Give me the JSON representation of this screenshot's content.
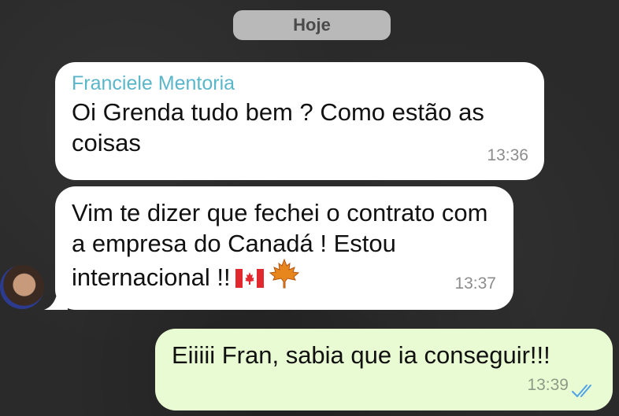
{
  "date_pill": "Hoje",
  "messages": [
    {
      "sender": "Franciele Mentoria",
      "text": "Oi Grenda tudo bem ? Como estão as coisas",
      "time": "13:36",
      "direction": "incoming"
    },
    {
      "text": "Vim te dizer que fechei o contrato com a empresa do Canadá ! Estou internacional !!",
      "time": "13:37",
      "direction": "incoming",
      "emoji": [
        "canada-flag-icon",
        "maple-leaf-icon"
      ]
    },
    {
      "text": "Eiiiii Fran, sabia que ia conseguir!!!",
      "time": "13:39",
      "direction": "outgoing",
      "status": "read"
    }
  ],
  "colors": {
    "background": "#2a2a2a",
    "incoming_bubble": "#ffffff",
    "outgoing_bubble": "#e9fbd2",
    "sender_name": "#5ab6c9",
    "read_ticks": "#4fa3e8",
    "date_pill": "#b9b9b9"
  }
}
